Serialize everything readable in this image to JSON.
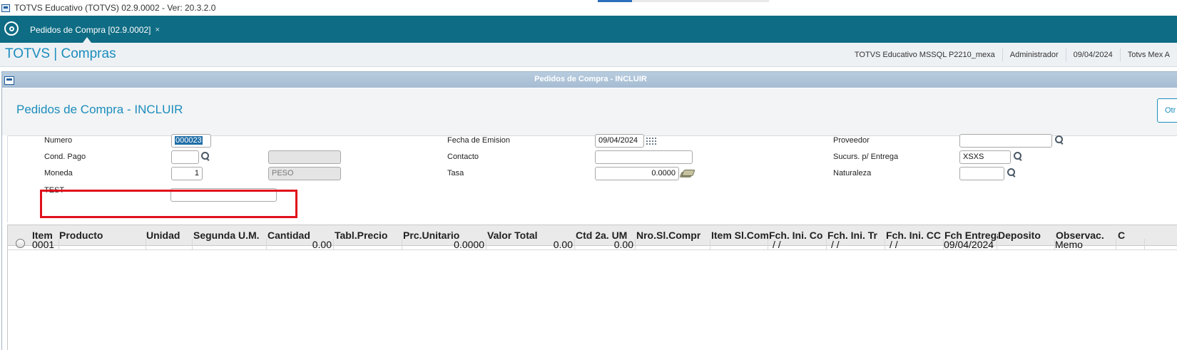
{
  "window": {
    "title": "TOTVS Educativo (TOTVS) 02.9.0002 - Ver: 20.3.2.0"
  },
  "tabs": [
    {
      "label": "Pedidos de Compra [02.9.0002]",
      "close": "×"
    }
  ],
  "header": {
    "app_title": "TOTVS | Compras",
    "info": [
      "TOTVS Educativo MSSQL P2210_mexa",
      "Administrador",
      "09/04/2024",
      "Totvs Mex A"
    ]
  },
  "dialog": {
    "title": "Pedidos de Compra - INCLUIR",
    "heading": "Pedidos de Compra - INCLUIR",
    "other_button": "Otr"
  },
  "form": {
    "numero": {
      "label": "Numero",
      "value": "000023"
    },
    "cond_pago": {
      "label": "Cond. Pago",
      "value": "",
      "desc": ""
    },
    "moneda": {
      "label": "Moneda",
      "value": "1",
      "desc": "PESO"
    },
    "test": {
      "label": "TEST",
      "value": ""
    },
    "fecha_emision": {
      "label": "Fecha de Emision",
      "value": "09/04/2024"
    },
    "contacto": {
      "label": "Contacto",
      "value": ""
    },
    "tasa": {
      "label": "Tasa",
      "value": "0.0000"
    },
    "proveedor": {
      "label": "Proveedor",
      "value": ""
    },
    "sucursal": {
      "label": "Sucurs. p/ Entrega",
      "value": "XSXS"
    },
    "naturaleza": {
      "label": "Naturaleza",
      "value": ""
    }
  },
  "grid": {
    "columns": [
      "Item",
      "Producto",
      "Unidad",
      "Segunda U.M.",
      "Cantidad",
      "Tabl.Precio",
      "Prc.Unitario",
      "Valor Total",
      "Ctd 2a. UM",
      "Nro.Sl.Compr",
      "Item Sl.Compr",
      "Fch. Ini. Co",
      "Fch. Ini. Tr",
      "Fch. Ini. CC",
      "Fch Entrega",
      "Deposito",
      "Observac.",
      "C"
    ],
    "rows": [
      [
        "0001",
        "",
        "",
        "",
        "0.00",
        "",
        "0.0000",
        "0.00",
        "0.00",
        "",
        "",
        " /  /",
        " /  /",
        " /  /",
        "09/04/2024",
        "",
        "Memo",
        ""
      ]
    ]
  }
}
